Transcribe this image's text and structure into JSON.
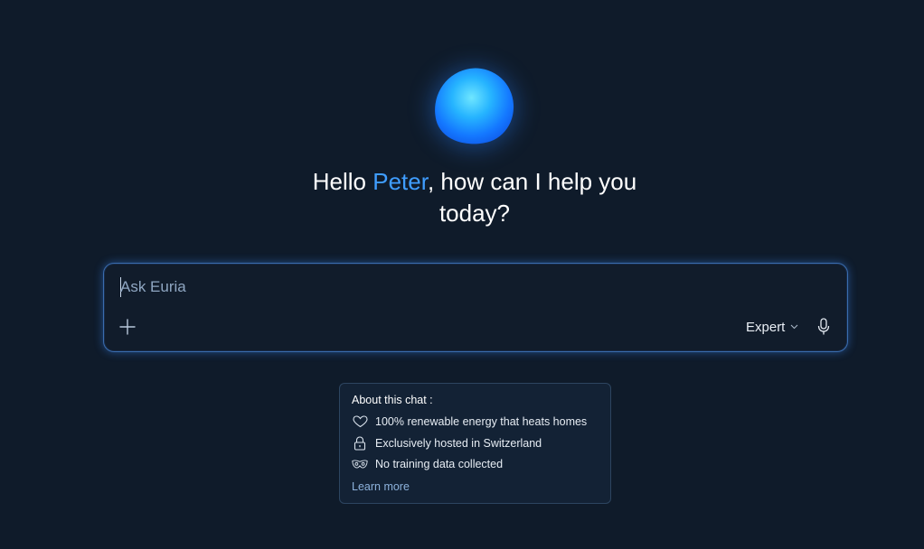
{
  "greeting": {
    "prefix": "Hello ",
    "name": "Peter",
    "suffix": ", how can I help you today?"
  },
  "composer": {
    "placeholder": "Ask Euria",
    "value": "",
    "add_icon": "plus-icon",
    "mode_label": "Expert",
    "mode_icon": "chevron-down-icon",
    "mic_icon": "microphone-icon"
  },
  "about": {
    "title": "About this chat :",
    "items": [
      {
        "icon": "heart-icon",
        "label": "100% renewable energy that heats homes"
      },
      {
        "icon": "lock-icon",
        "label": "Exclusively hosted in Switzerland"
      },
      {
        "icon": "mask-icon",
        "label": "No training data collected"
      }
    ],
    "learn_more": "Learn more"
  },
  "colors": {
    "background": "#0f1b2a",
    "accent": "#3f9dff",
    "composer_border": "#3a6cae",
    "card_background": "#132235",
    "link": "#8db2dc"
  }
}
